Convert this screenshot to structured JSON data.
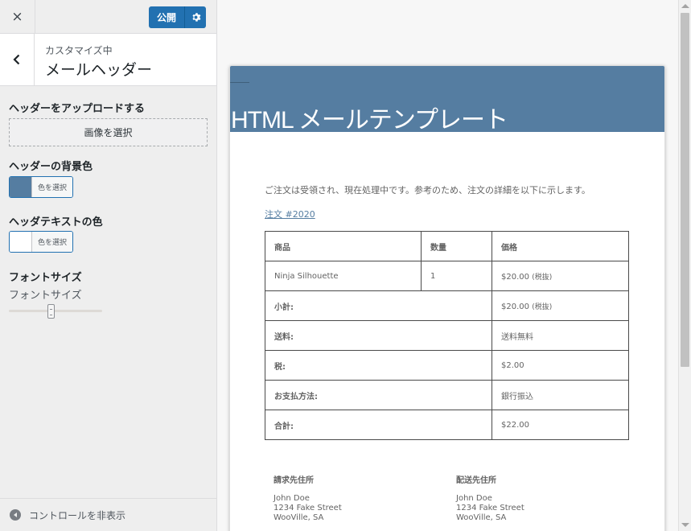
{
  "topbar": {
    "close_icon": "×",
    "publish_label": "公開",
    "gear_icon": "gear-icon"
  },
  "section": {
    "customizing": "カスタマイズ中",
    "title": "メールヘッダー"
  },
  "controls": {
    "header_upload_label": "ヘッダーをアップロードする",
    "select_image_button": "画像を選択",
    "bg_color_label": "ヘッダーの背景色",
    "bg_color_value": "#557da1",
    "select_color": "色を選択",
    "text_color_label": "ヘッダテキストの色",
    "text_color_value": "#ffffff",
    "font_size_label": "フォントサイズ",
    "font_size_sublabel": "フォントサイズ",
    "font_size_slider_level": 0.45
  },
  "footer": {
    "hide_controls": "コントロールを非表示"
  },
  "email": {
    "header_bg": "#557da1",
    "title": "HTML メールテンプレート",
    "intro": "ご注文は受領され、現在処理中です。参考のため、注文の詳細を以下に示します。",
    "order_link": "注文 #2020",
    "table": {
      "headers": [
        "商品",
        "数量",
        "価格"
      ],
      "item": {
        "name": "Ninja Silhouette",
        "qty": "1",
        "price": "$20.00",
        "tax_note": "(税抜)"
      },
      "subtotal_label": "小計:",
      "subtotal_value": "$20.00",
      "subtotal_note": "(税抜)",
      "shipping_label": "送料:",
      "shipping_value": "送料無料",
      "tax_label": "税:",
      "tax_value": "$2.00",
      "payment_label": "お支払方法:",
      "payment_value": "銀行振込",
      "total_label": "合計:",
      "total_value": "$22.00"
    },
    "billing": {
      "title": "請求先住所",
      "name": "John Doe",
      "street": "1234 Fake Street",
      "city": "WooVille, SA"
    },
    "shipping": {
      "title": "配送先住所",
      "name": "John Doe",
      "street": "1234 Fake Street",
      "city": "WooVille, SA"
    }
  },
  "colors": {
    "accent": "#2271b1",
    "header": "#557da1"
  }
}
